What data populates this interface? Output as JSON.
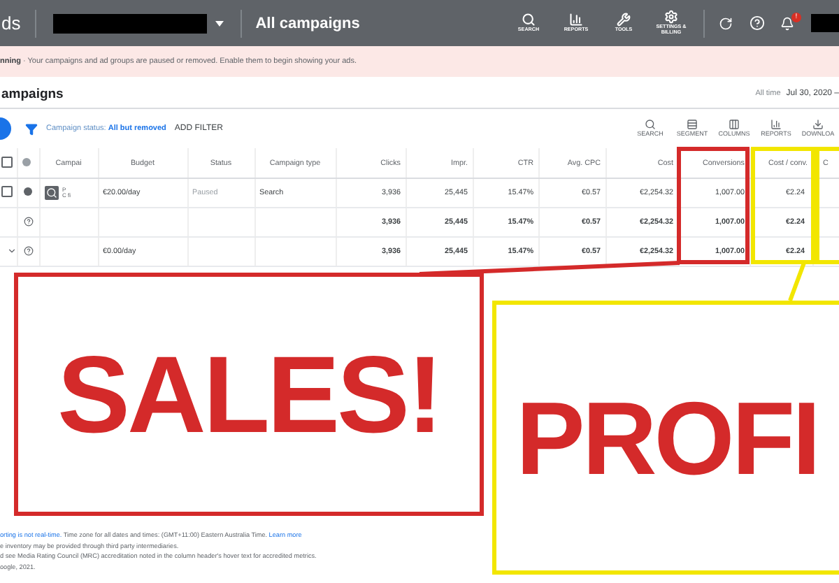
{
  "topbar": {
    "brand": "ds",
    "title": "All campaigns",
    "tools": [
      {
        "kind": "search",
        "label": "SEARCH"
      },
      {
        "kind": "reports",
        "label": "REPORTS"
      },
      {
        "kind": "tools",
        "label": "TOOLS"
      },
      {
        "kind": "settings",
        "label": "SETTINGS & BILLING"
      }
    ],
    "notification_badge": "!"
  },
  "banner": {
    "lead": "nning",
    "text": " · Your campaigns and ad groups are paused or removed. Enable them to begin showing your ads."
  },
  "page_title": "ampaigns",
  "date_range": {
    "label": "All time",
    "value": "Jul 30, 2020 – "
  },
  "filter": {
    "label": "Campaign status:",
    "value": "All but removed",
    "add": "ADD FILTER"
  },
  "table_tools": [
    {
      "kind": "search",
      "label": "SEARCH"
    },
    {
      "kind": "segment",
      "label": "SEGMENT"
    },
    {
      "kind": "columns",
      "label": "COLUMNS"
    },
    {
      "kind": "reports",
      "label": "REPORTS"
    },
    {
      "kind": "download",
      "label": "DOWNLOA"
    }
  ],
  "table": {
    "select_all_checked": false,
    "columns": [
      "Campai",
      "Budget",
      "Status",
      "Campaign type",
      "Clicks",
      "Impr.",
      "CTR",
      "Avg. CPC",
      "Cost",
      "Conversions",
      "Cost / conv.",
      "C"
    ],
    "rows": [
      {
        "kind": "campaign",
        "checked": false,
        "name": "P C fi",
        "budget": "€20.00/day",
        "status": "Paused",
        "type": "Search",
        "metrics": [
          "3,936",
          "25,445",
          "15.47%",
          "€0.57",
          "€2,254.32",
          "1,007.00",
          "€2.24"
        ]
      },
      {
        "kind": "total",
        "name": "",
        "budget": "",
        "status": "",
        "type": "",
        "metrics": [
          "3,936",
          "25,445",
          "15.47%",
          "€0.57",
          "€2,254.32",
          "1,007.00",
          "€2.24"
        ]
      },
      {
        "kind": "summary",
        "name": "",
        "budget": "€0.00/day",
        "status": "",
        "type": "",
        "metrics": [
          "3,936",
          "25,445",
          "15.47%",
          "€0.57",
          "€2,254.32",
          "1,007.00",
          "€2.24"
        ]
      }
    ]
  },
  "callouts": [
    {
      "kind": "sales",
      "text": "SALES!",
      "color": "#d42a2a"
    },
    {
      "kind": "profit",
      "text": "PROFI",
      "color": "#f2e600"
    }
  ],
  "footer": [
    {
      "parts": [
        {
          "text": "orting is not real-time.",
          "link": true
        },
        {
          "text": " Time zone for all dates and times: (GMT+11:00) Eastern Australia Time. ",
          "link": false
        },
        {
          "text": "Learn more",
          "link": true
        }
      ]
    },
    {
      "parts": [
        {
          "text": "e inventory may be provided through third party intermediaries.",
          "link": false
        }
      ]
    },
    {
      "parts": [
        {
          "text": "d see Media Rating Council (MRC) accreditation noted in the column header's hover text for accredited metrics.",
          "link": false
        }
      ]
    },
    {
      "parts": [
        {
          "text": "oogle, 2021.",
          "link": false
        }
      ]
    }
  ]
}
